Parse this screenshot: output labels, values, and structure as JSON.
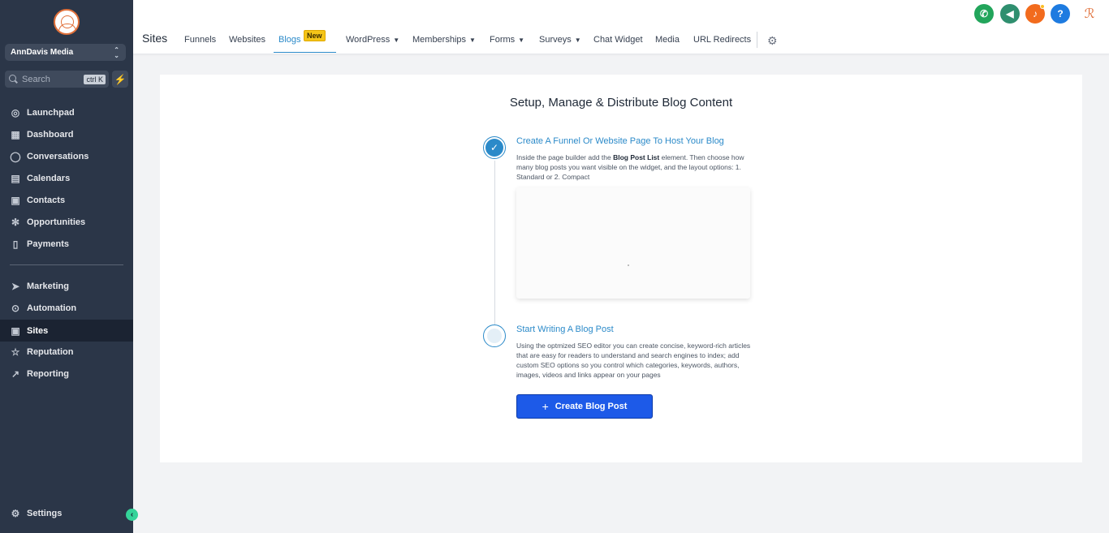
{
  "sidebar": {
    "account_name": "AnnDavis Media",
    "search_placeholder": "Search",
    "search_shortcut": "ctrl K",
    "items_top": [
      {
        "label": "Launchpad",
        "icon": "rocket-icon"
      },
      {
        "label": "Dashboard",
        "icon": "grid-icon"
      },
      {
        "label": "Conversations",
        "icon": "chat-icon"
      },
      {
        "label": "Calendars",
        "icon": "calendar-icon"
      },
      {
        "label": "Contacts",
        "icon": "contacts-icon"
      },
      {
        "label": "Opportunities",
        "icon": "opportunities-icon"
      },
      {
        "label": "Payments",
        "icon": "payments-icon"
      }
    ],
    "items_bottom": [
      {
        "label": "Marketing",
        "icon": "send-icon"
      },
      {
        "label": "Automation",
        "icon": "automation-icon"
      },
      {
        "label": "Sites",
        "icon": "sites-icon",
        "active": true
      },
      {
        "label": "Reputation",
        "icon": "star-icon"
      },
      {
        "label": "Reporting",
        "icon": "trend-icon"
      }
    ],
    "settings_label": "Settings"
  },
  "header": {
    "title": "Sites",
    "tabs": [
      {
        "label": "Funnels"
      },
      {
        "label": "Websites"
      },
      {
        "label": "Blogs",
        "active": true,
        "badge": "New"
      },
      {
        "label": "WordPress",
        "dropdown": true
      },
      {
        "label": "Memberships",
        "dropdown": true
      },
      {
        "label": "Forms",
        "dropdown": true
      },
      {
        "label": "Surveys",
        "dropdown": true
      },
      {
        "label": "Chat Widget"
      },
      {
        "label": "Media"
      },
      {
        "label": "URL Redirects"
      }
    ],
    "icons": [
      {
        "name": "phone-icon",
        "color": "#22a55b",
        "glyph": "✆"
      },
      {
        "name": "megaphone-icon",
        "color": "#2f8f6f",
        "glyph": "📢"
      },
      {
        "name": "bell-icon",
        "color": "#f26b1d",
        "glyph": "🔔"
      },
      {
        "name": "help-icon",
        "color": "#1e7be0",
        "glyph": "?"
      }
    ],
    "avatar_glyph": "ℛ"
  },
  "main": {
    "title": "Setup, Manage & Distribute Blog Content",
    "step1": {
      "title": "Create A Funnel Or Website Page To Host Your Blog",
      "desc_before": "Inside the page builder add the ",
      "desc_bold": "Blog Post List",
      "desc_after": " element. Then choose how many blog posts you want visible on the widget, and the layout options: 1. Standard or 2. Compact"
    },
    "step2": {
      "title": "Start Writing A Blog Post",
      "desc": "Using the optmized SEO editor you can create concise, keyword-rich articles that are easy for readers to understand and search engines to index; add custom SEO options so you control which categories, keywords, authors, images, videos and links appear on your pages"
    },
    "create_button": "Create Blog Post"
  },
  "colors": {
    "sidebar_bg": "#2b3648",
    "accent": "#2b8ac9",
    "button": "#1d5ae8",
    "badge": "#f5c518"
  }
}
